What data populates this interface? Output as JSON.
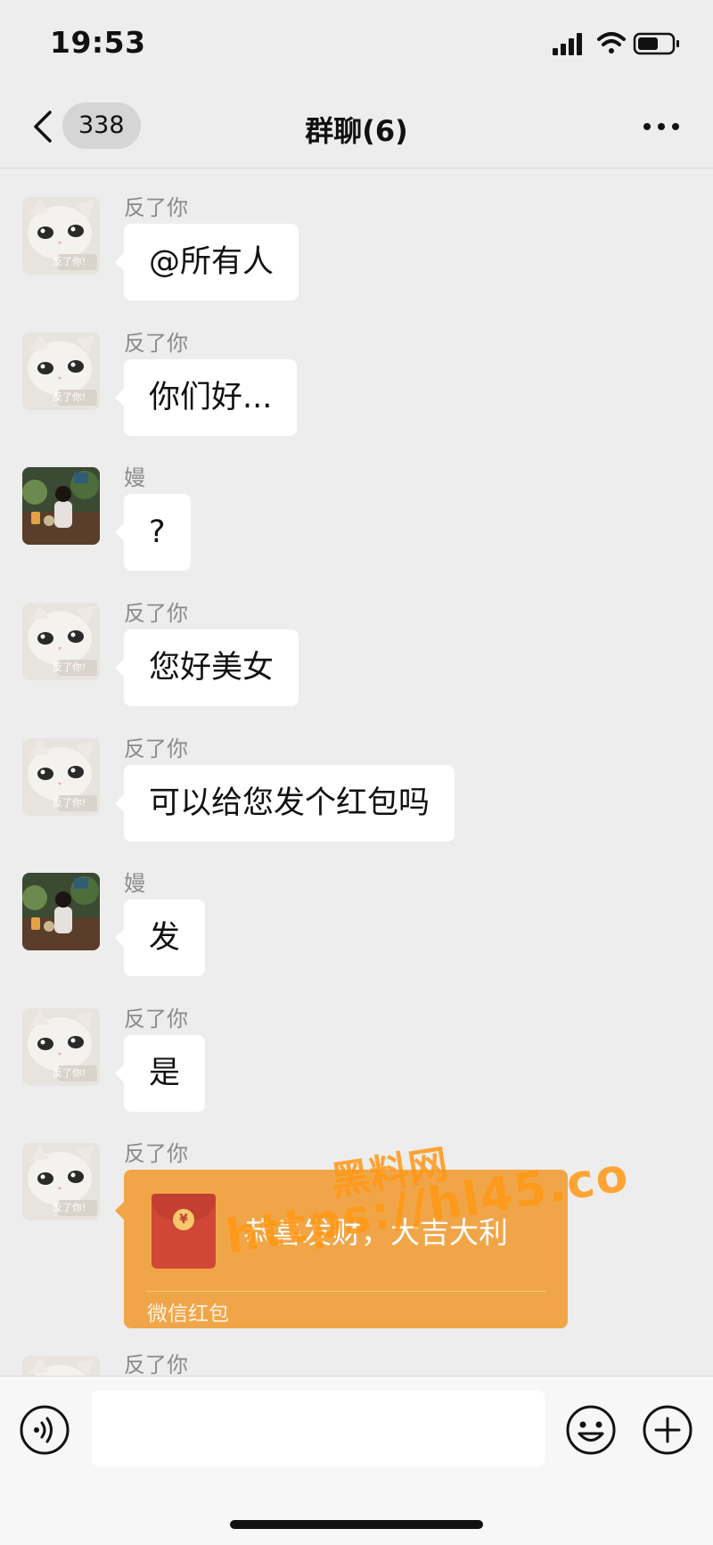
{
  "status_bar": {
    "time": "19:53",
    "icons": [
      "signal-icon",
      "wifi-icon",
      "battery-icon"
    ]
  },
  "header": {
    "back_icon": "chevron-left-icon",
    "unread_count": "338",
    "title": "群聊(6)",
    "more_icon": "more-dots-icon"
  },
  "messages": [
    {
      "sender": "反了你",
      "text": "@所有人",
      "avatar": "cat-avatar"
    },
    {
      "sender": "反了你",
      "text": "你们好...",
      "avatar": "cat-avatar"
    },
    {
      "sender": "嫚",
      "text": "?",
      "avatar": "photo-avatar"
    },
    {
      "sender": "反了你",
      "text": "您好美女",
      "avatar": "cat-avatar"
    },
    {
      "sender": "反了你",
      "text": "可以给您发个红包吗",
      "avatar": "cat-avatar"
    },
    {
      "sender": "嫚",
      "text": "发",
      "avatar": "photo-avatar"
    },
    {
      "sender": "反了你",
      "text": "是",
      "avatar": "cat-avatar"
    },
    {
      "sender": "反了你",
      "red_packet": {
        "message": "恭喜发财，大吉大利",
        "label": "微信红包"
      },
      "avatar": "cat-avatar"
    },
    {
      "sender": "反了你",
      "avatar": "cat-avatar"
    }
  ],
  "avatar_caption": "反了你!",
  "watermark": {
    "line1": "黑料网",
    "line2": "https://hl45.co"
  },
  "input_bar": {
    "voice_icon": "voice-icon",
    "input_value": "",
    "emoji_icon": "emoji-icon",
    "plus_icon": "plus-icon"
  },
  "colors": {
    "background": "#ededed",
    "bubble": "#ffffff",
    "red_packet": "#f0a648",
    "red_packet_envelope": "#d14735"
  }
}
